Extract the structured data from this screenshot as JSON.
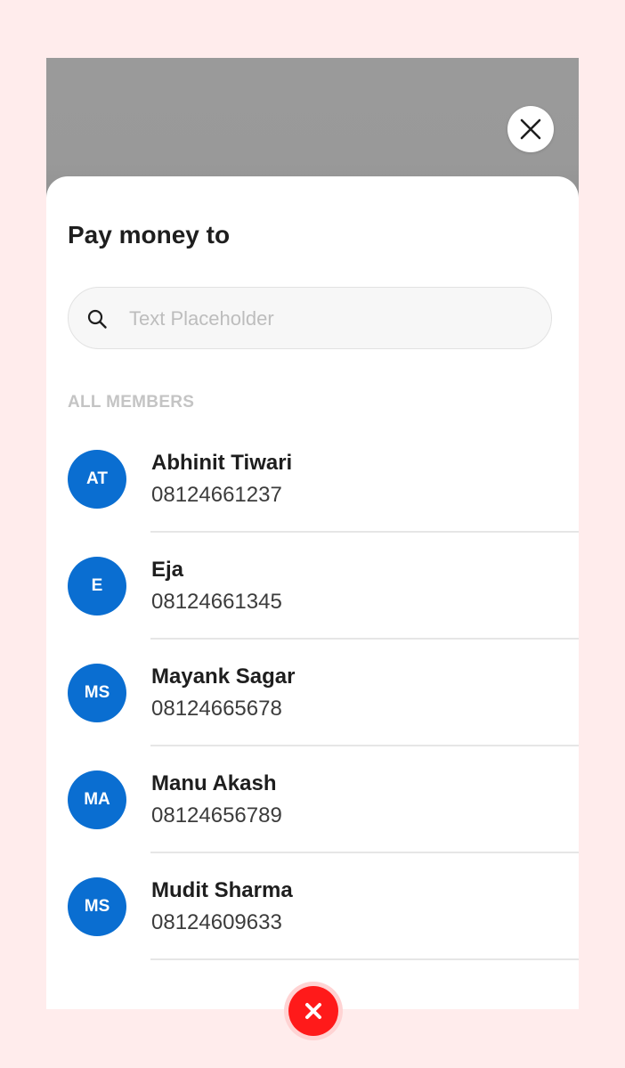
{
  "sheet": {
    "title": "Pay money to",
    "search": {
      "placeholder": "Text Placeholder",
      "value": "",
      "icon": "search-icon"
    },
    "section_label": "ALL MEMBERS",
    "members": [
      {
        "initials": "AT",
        "name": "Abhinit Tiwari",
        "phone": "08124661237"
      },
      {
        "initials": "E",
        "name": "Eja",
        "phone": "08124661345"
      },
      {
        "initials": "MS",
        "name": "Mayank Sagar",
        "phone": "08124665678"
      },
      {
        "initials": "MA",
        "name": "Manu Akash",
        "phone": "08124656789"
      },
      {
        "initials": "MS",
        "name": "Mudit Sharma",
        "phone": "08124609633"
      }
    ]
  },
  "icons": {
    "top_close": "close-icon",
    "bottom_close": "close-icon"
  },
  "colors": {
    "avatar": "#0a6ed1",
    "close_button": "#ff1a1a",
    "background": "#ffecec"
  }
}
